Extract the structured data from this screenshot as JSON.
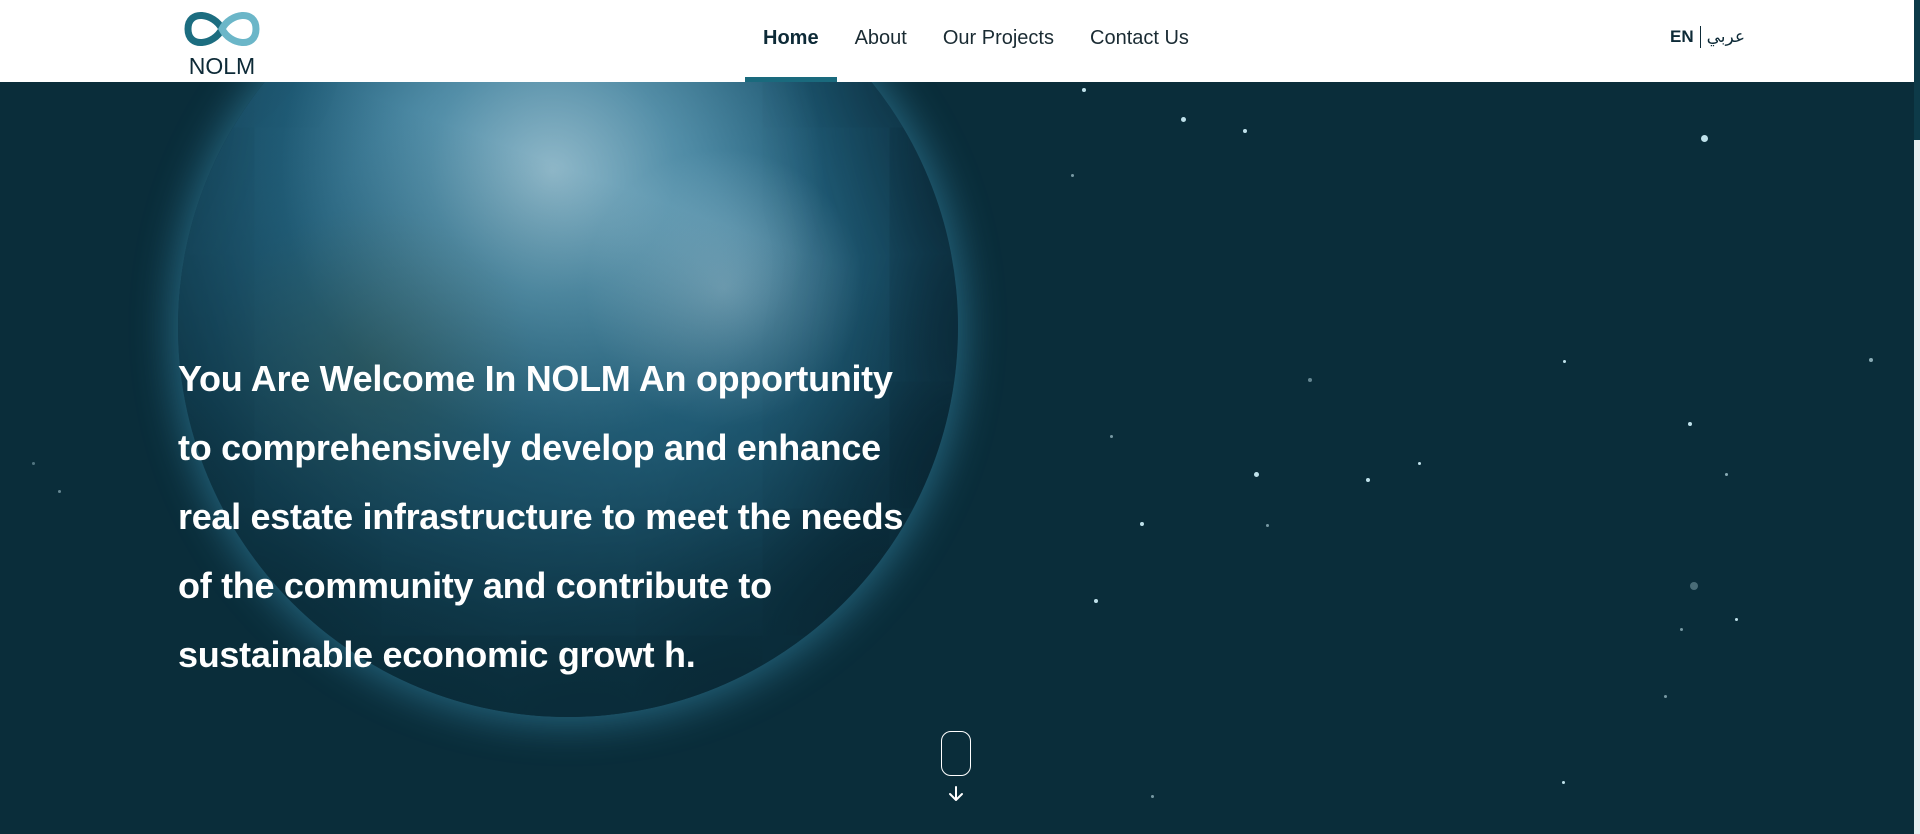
{
  "brand": {
    "logo_text": "NOLM"
  },
  "nav": {
    "items": [
      {
        "label": "Home",
        "active": true
      },
      {
        "label": "About",
        "active": false
      },
      {
        "label": "Our Projects",
        "active": false
      },
      {
        "label": "Contact Us",
        "active": false
      }
    ]
  },
  "language": {
    "current": "EN",
    "alternate": "عربي"
  },
  "hero": {
    "headline": "You Are Welcome In NOLM An opportunity to comprehensively develop and enhance real estate infrastructure to meet the needs of the community and contribute to sustainable economic growt h."
  },
  "colors": {
    "accent": "#1a6a7d",
    "hero_background": "#0a2d3a",
    "header_background": "#ffffff"
  },
  "icons": {
    "scroll_indicator": "mouse-icon",
    "scroll_arrow": "arrow-down-icon"
  }
}
